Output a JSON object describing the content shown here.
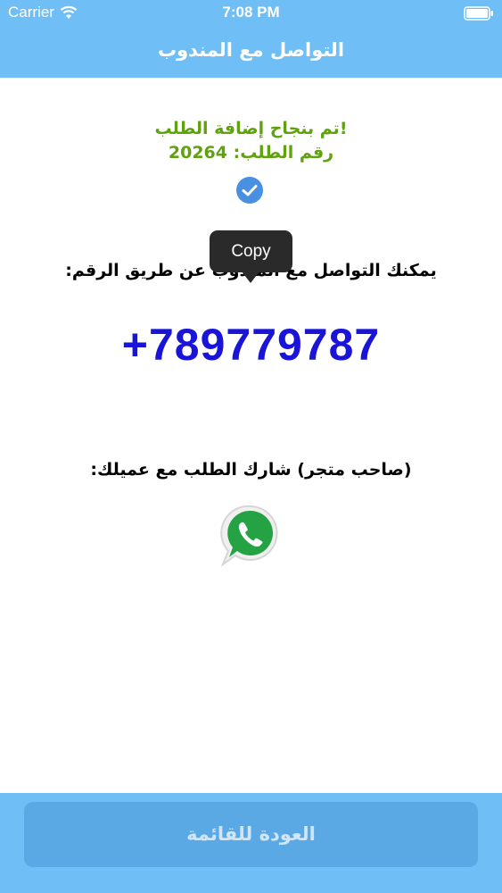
{
  "status_bar": {
    "carrier": "Carrier",
    "time": "7:08 PM",
    "wifi_icon": "wifi-icon",
    "battery_icon": "battery-icon"
  },
  "nav": {
    "title": "التواصل مع المندوب"
  },
  "order": {
    "success_message": "تم بنجاح إضافة الطلب!",
    "number_label": "رقم الطلب:",
    "number": "20264",
    "check_icon": "check-circle-icon"
  },
  "contact": {
    "label": "يمكنك التواصل مع المندوب عن طريق الرقم:",
    "phone": "+789779787",
    "copy_tooltip": "Copy"
  },
  "share": {
    "label": "(صاحب متجر) شارك الطلب مع عميلك:",
    "icon": "whatsapp-icon"
  },
  "footer": {
    "back_button_label": "العودة للقائمة"
  },
  "colors": {
    "bar_blue": "#6fbef6",
    "button_blue": "#5aa9e4",
    "success_green": "#5fa10e",
    "phone_blue": "#1a13d8",
    "check_blue": "#4a90e2",
    "whatsapp_green": "#25a244"
  }
}
